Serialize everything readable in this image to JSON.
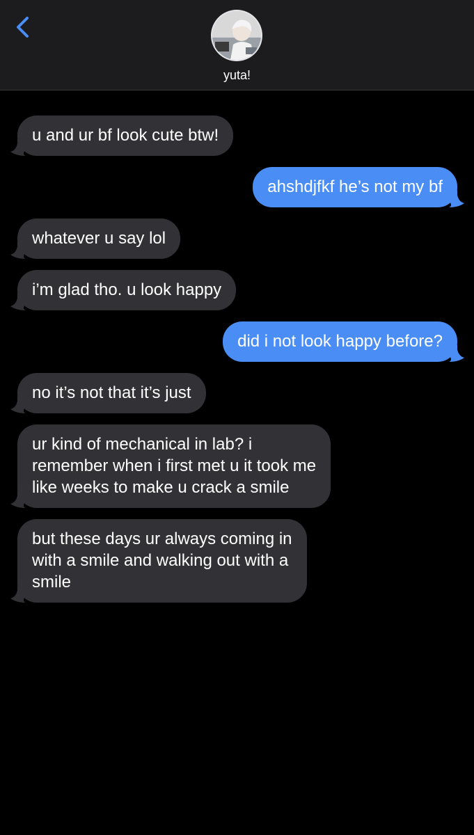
{
  "header": {
    "contact_name": "yuta!"
  },
  "colors": {
    "incoming_bubble": "#323236",
    "outgoing_bubble": "#4a8ef5",
    "accent": "#3b82f6",
    "header_bg": "#1c1c1e",
    "background": "#000000"
  },
  "messages": [
    {
      "direction": "incoming",
      "text": "u and ur bf look cute btw!"
    },
    {
      "direction": "outgoing",
      "text": "ahshdjfkf he’s not my bf"
    },
    {
      "direction": "incoming",
      "text": "whatever u say lol"
    },
    {
      "direction": "incoming",
      "text": "i’m glad tho. u look happy"
    },
    {
      "direction": "outgoing",
      "text": "did i not look happy before?"
    },
    {
      "direction": "incoming",
      "text": "no it’s not that it’s just"
    },
    {
      "direction": "incoming",
      "text": "ur kind of mechanical in lab? i\nremember when i first met u it took me\nlike weeks to make u crack a smile"
    },
    {
      "direction": "incoming",
      "text": "but these days ur always coming in\nwith a smile and walking out with a\nsmile"
    }
  ]
}
